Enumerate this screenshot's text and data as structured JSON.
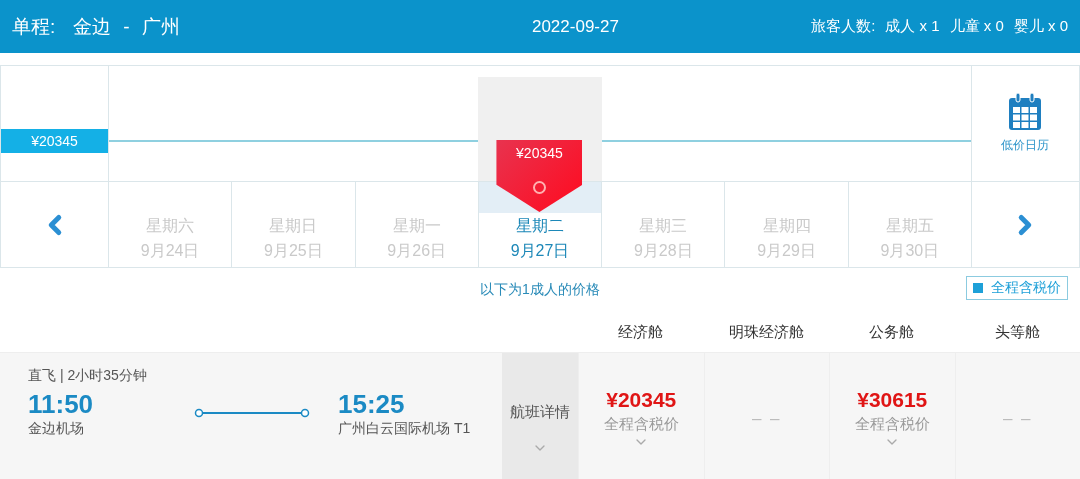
{
  "header": {
    "trip_type": "单程:",
    "origin": "金边",
    "separator": "-",
    "destination": "广州",
    "date": "2022-09-27",
    "passengers_label": "旅客人数:",
    "passengers": [
      "成人 x 1",
      "儿童 x 0",
      "婴儿 x 0"
    ]
  },
  "price_chart": {
    "axis_price": "¥20345",
    "calendar_label": "低价日历"
  },
  "days": [
    {
      "weekday": "星期六",
      "date": "9月24日",
      "selected": false
    },
    {
      "weekday": "星期日",
      "date": "9月25日",
      "selected": false
    },
    {
      "weekday": "星期一",
      "date": "9月26日",
      "selected": false
    },
    {
      "weekday": "星期二",
      "date": "9月27日",
      "selected": true,
      "price": "¥20345"
    },
    {
      "weekday": "星期三",
      "date": "9月28日",
      "selected": false
    },
    {
      "weekday": "星期四",
      "date": "9月29日",
      "selected": false
    },
    {
      "weekday": "星期五",
      "date": "9月30日",
      "selected": false
    }
  ],
  "price_note": "以下为1成人的价格",
  "tax_toggle": {
    "label": "全程含税价",
    "checked": true
  },
  "cabins": [
    "经济舱",
    "明珠经济舱",
    "公务舱",
    "头等舱"
  ],
  "flight": {
    "summary": "直飞 | 2小时35分钟",
    "depart_time": "11:50",
    "depart_airport": "金边机场",
    "arrive_time": "15:25",
    "arrive_airport": "广州白云国际机场 T1",
    "details_label": "航班详情",
    "fares": [
      {
        "kind": "fare",
        "price": "¥20345",
        "note": "全程含税价"
      },
      {
        "kind": "none",
        "price": "– –"
      },
      {
        "kind": "fare",
        "price": "¥30615",
        "note": "全程含税价"
      },
      {
        "kind": "none",
        "price": "– –"
      }
    ]
  }
}
